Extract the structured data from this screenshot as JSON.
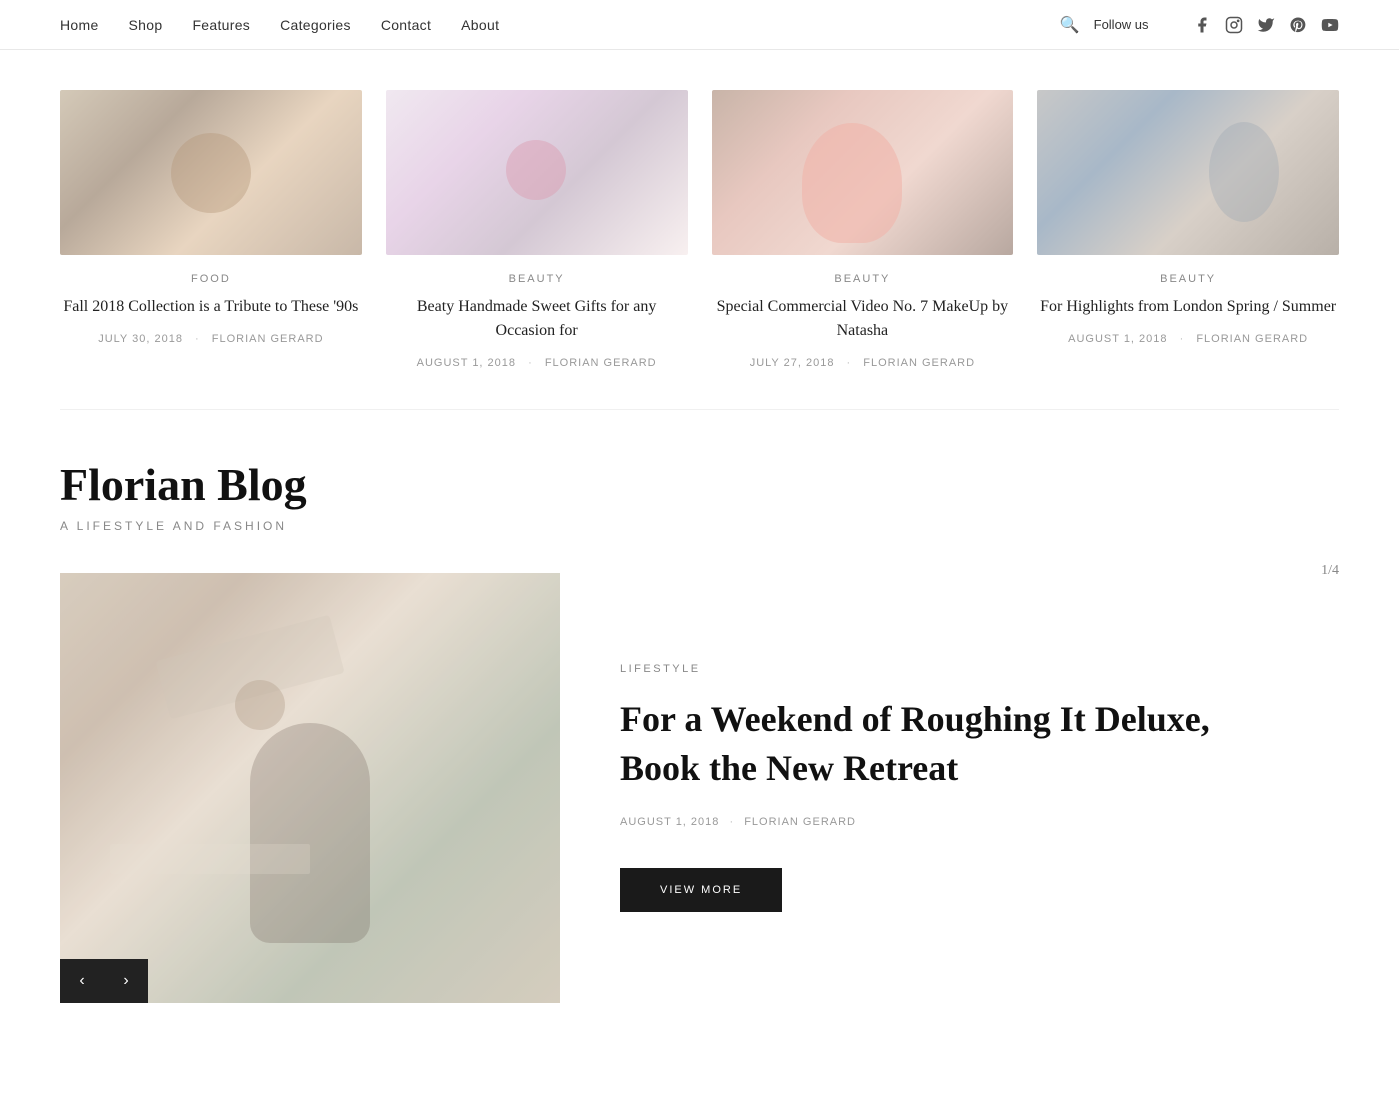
{
  "nav": {
    "links": [
      {
        "label": "Home",
        "href": "#"
      },
      {
        "label": "Shop",
        "href": "#"
      },
      {
        "label": "Features",
        "href": "#"
      },
      {
        "label": "Categories",
        "href": "#"
      },
      {
        "label": "Contact",
        "href": "#"
      },
      {
        "label": "About",
        "href": "#"
      }
    ],
    "follow_label": "Follow us",
    "social_icons": [
      "facebook",
      "instagram",
      "twitter",
      "pinterest",
      "youtube"
    ]
  },
  "cards": [
    {
      "category": "FOOD",
      "title": "Fall 2018 Collection is a Tribute to These '90s",
      "date": "JULY 30, 2018",
      "author": "FLORIAN GERARD",
      "img_class": "food-img"
    },
    {
      "category": "BEAUTY",
      "title": "Beaty Handmade Sweet Gifts for any Occasion for",
      "date": "AUGUST 1, 2018",
      "author": "FLORIAN GERARD",
      "img_class": "beauty1-img"
    },
    {
      "category": "BEAUTY",
      "title": "Special Commercial Video No. 7 MakeUp by Natasha",
      "date": "JULY 27, 2018",
      "author": "FLORIAN GERARD",
      "img_class": "beauty2-img"
    },
    {
      "category": "BEAUTY",
      "title": "For Highlights from London Spring / Summer",
      "date": "AUGUST 1, 2018",
      "author": "FLORIAN GERARD",
      "img_class": "beauty3-img"
    }
  ],
  "blog": {
    "title": "Florian Blog",
    "subtitle": "A LIFESTYLE AND FASHION"
  },
  "featured": {
    "slide_counter": "1/4",
    "category": "LIFESTYLE",
    "title": "For a Weekend of Roughing It Deluxe, Book the New Retreat",
    "date": "AUGUST 1, 2018",
    "author": "FLORIAN GERARD",
    "view_more_label": "VIEW MORE",
    "prev_label": "‹",
    "next_label": "›"
  }
}
